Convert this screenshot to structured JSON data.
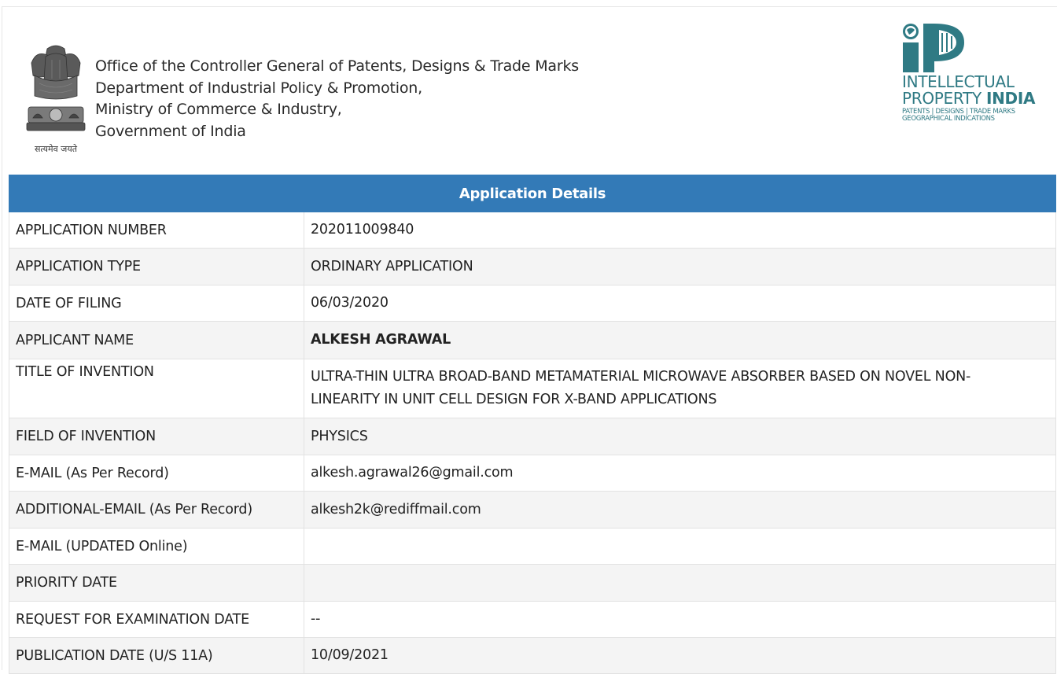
{
  "header": {
    "emblem_motto": "सत्यमेव जयते",
    "office_lines": [
      "Office of the Controller General of Patents, Designs & Trade Marks",
      "Department of Industrial Policy & Promotion,",
      "Ministry of Commerce & Industry,",
      "Government of India"
    ],
    "logo": {
      "line1": "INTELLECTUAL",
      "line2a": "PROPERTY ",
      "line2b": "INDIA",
      "sub1": "PATENTS | DESIGNS | TRADE MARKS",
      "sub2": "GEOGRAPHICAL INDICATIONS",
      "color": "#2f7a84"
    }
  },
  "table": {
    "title": "Application Details",
    "header_color": "#337ab7",
    "rows": [
      {
        "label": "APPLICATION NUMBER",
        "value": "202011009840"
      },
      {
        "label": "APPLICATION TYPE",
        "value": "ORDINARY APPLICATION"
      },
      {
        "label": "DATE OF FILING",
        "value": "06/03/2020"
      },
      {
        "label": "APPLICANT NAME",
        "value": "ALKESH AGRAWAL"
      },
      {
        "label": "TITLE OF INVENTION",
        "value": "ULTRA-THIN ULTRA BROAD-BAND METAMATERIAL MICROWAVE ABSORBER BASED ON NOVEL NON-LINEARITY IN UNIT CELL DESIGN FOR X-BAND APPLICATIONS"
      },
      {
        "label": "FIELD OF INVENTION",
        "value": "PHYSICS"
      },
      {
        "label": "E-MAIL (As Per Record)",
        "value": "alkesh.agrawal26@gmail.com"
      },
      {
        "label": "ADDITIONAL-EMAIL (As Per Record)",
        "value": "alkesh2k@rediffmail.com"
      },
      {
        "label": "E-MAIL (UPDATED Online)",
        "value": ""
      },
      {
        "label": "PRIORITY DATE",
        "value": ""
      },
      {
        "label": "REQUEST FOR EXAMINATION DATE",
        "value": "--"
      },
      {
        "label": "PUBLICATION DATE (U/S 11A)",
        "value": "10/09/2021"
      }
    ]
  }
}
